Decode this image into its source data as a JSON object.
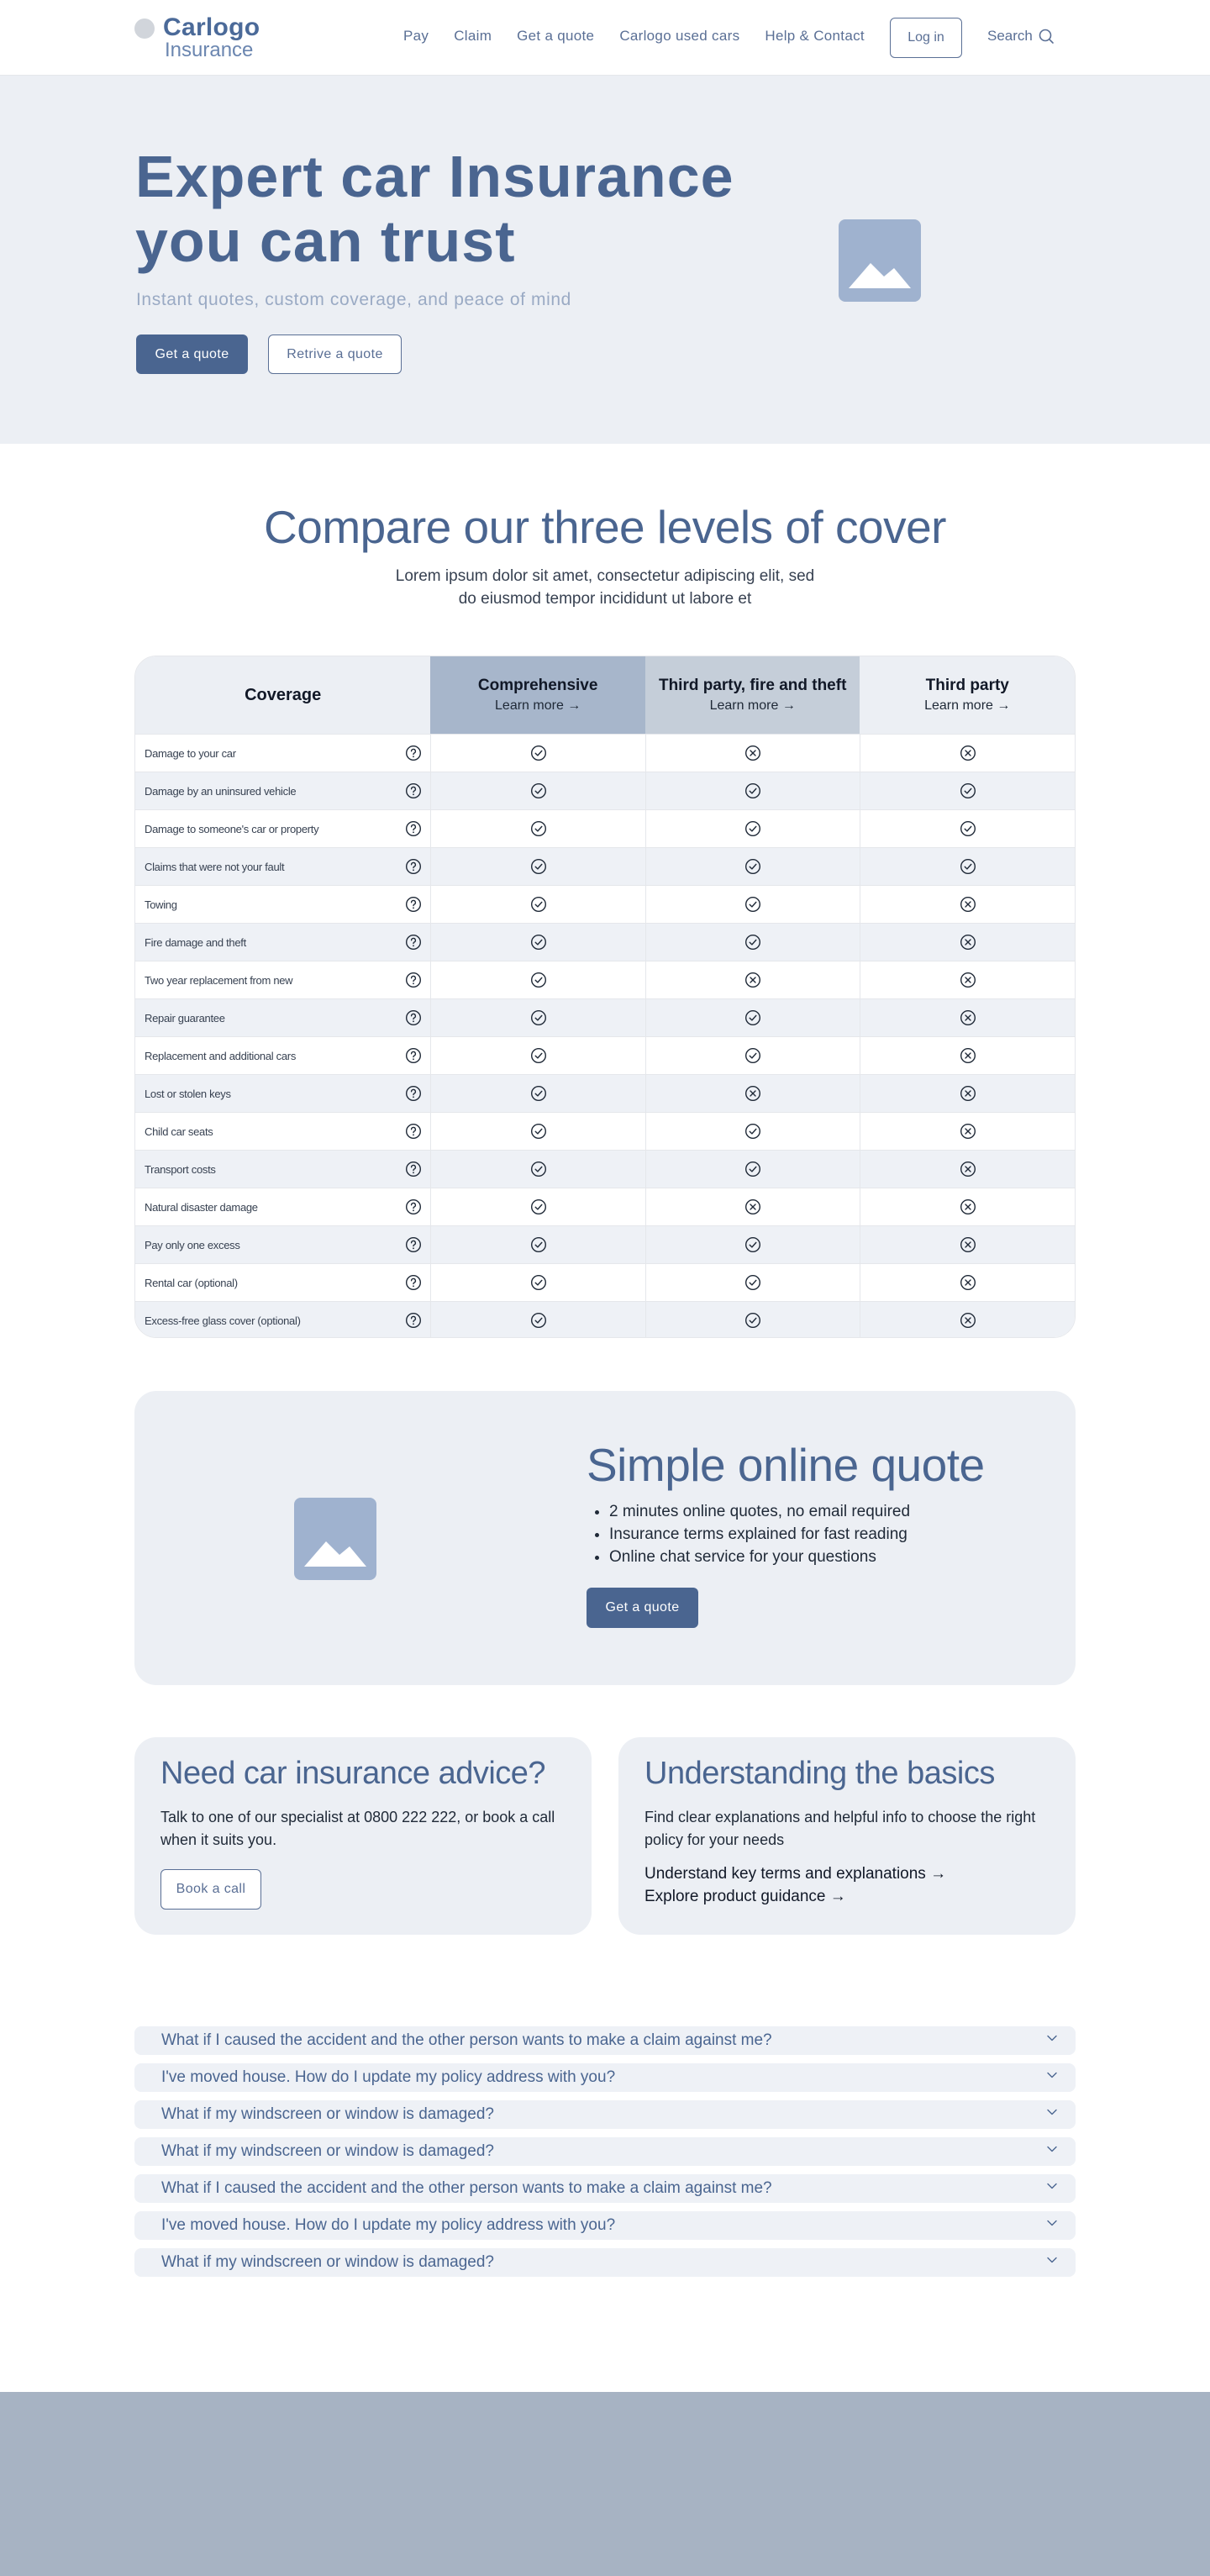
{
  "brand": {
    "name_line1": "Carlogo",
    "name_line2": "Insurance"
  },
  "nav": {
    "items": [
      "Pay",
      "Claim",
      "Get a quote",
      "Carlogo used cars",
      "Help & Contact"
    ],
    "login": "Log in",
    "search": "Search"
  },
  "hero": {
    "title_line1": "Expert car Insurance",
    "title_line2": "you can trust",
    "subtitle": "Instant quotes, custom coverage, and peace of mind",
    "primary_btn": "Get a quote",
    "secondary_btn": "Retrive a quote"
  },
  "compare": {
    "title": "Compare our three levels of cover",
    "subtitle": "Lorem ipsum dolor sit amet, consectetur adipiscing elit, sed do eiusmod tempor incididunt ut labore et",
    "col_coverage": "Coverage",
    "plans": [
      {
        "name": "Comprehensive",
        "link": "Learn more →"
      },
      {
        "name": "Third party, fire and theft",
        "link": "Learn more →"
      },
      {
        "name": "Third party",
        "link": "Learn more  →"
      }
    ],
    "rows": [
      {
        "label": "Damage to your car",
        "values": [
          true,
          false,
          false
        ]
      },
      {
        "label": "Damage by an uninsured vehicle",
        "values": [
          true,
          true,
          true
        ]
      },
      {
        "label": "Damage to someone's car or property",
        "values": [
          true,
          true,
          true
        ]
      },
      {
        "label": "Claims that were not your fault",
        "values": [
          true,
          true,
          true
        ]
      },
      {
        "label": "Towing",
        "values": [
          true,
          true,
          false
        ]
      },
      {
        "label": "Fire damage and theft",
        "values": [
          true,
          true,
          false
        ]
      },
      {
        "label": "Two year replacement from new",
        "values": [
          true,
          false,
          false
        ]
      },
      {
        "label": "Repair guarantee",
        "values": [
          true,
          true,
          false
        ]
      },
      {
        "label": "Replacement and additional cars",
        "values": [
          true,
          true,
          false
        ]
      },
      {
        "label": "Lost or stolen keys",
        "values": [
          true,
          false,
          false
        ]
      },
      {
        "label": "Child car seats",
        "values": [
          true,
          true,
          false
        ]
      },
      {
        "label": "Transport costs",
        "values": [
          true,
          true,
          false
        ]
      },
      {
        "label": "Natural disaster damage",
        "values": [
          true,
          false,
          false
        ]
      },
      {
        "label": "Pay only one excess",
        "values": [
          true,
          true,
          false
        ]
      },
      {
        "label": "Rental car (optional)",
        "values": [
          true,
          true,
          false
        ]
      },
      {
        "label": "Excess-free glass cover (optional)",
        "values": [
          true,
          true,
          false
        ]
      }
    ]
  },
  "quote": {
    "title": "Simple online quote",
    "bullets": [
      "2 minutes online quotes, no email required",
      "Insurance terms explained for fast reading",
      "Online chat service for your questions"
    ],
    "button": "Get a quote"
  },
  "advice": {
    "title": "Need car insurance advice?",
    "text": " Talk to one of our  specialist at 0800 222 222, or book a call when it suits you.",
    "button": "Book a call"
  },
  "basics": {
    "title": "Understanding the basics",
    "text": "Find clear explanations and helpful info to choose the right policy for your needs",
    "links": [
      "Understand key terms and explanations →",
      "Explore product guidance  →"
    ]
  },
  "faq": [
    "What if I caused the accident and the other person wants to make a claim against me?",
    "I've moved house. How do I update my policy address with you?",
    "What if my windscreen or window is damaged?",
    "What if my windscreen or window is damaged?",
    "What if I caused the accident and the other person wants to make a claim against me?",
    "I've moved house. How do I update my policy address with you?",
    "What if my windscreen or window is damaged?"
  ],
  "colors": {
    "primary": "#4a6590",
    "soft_bg": "#eceff4",
    "footer": "#a7b3c3"
  }
}
